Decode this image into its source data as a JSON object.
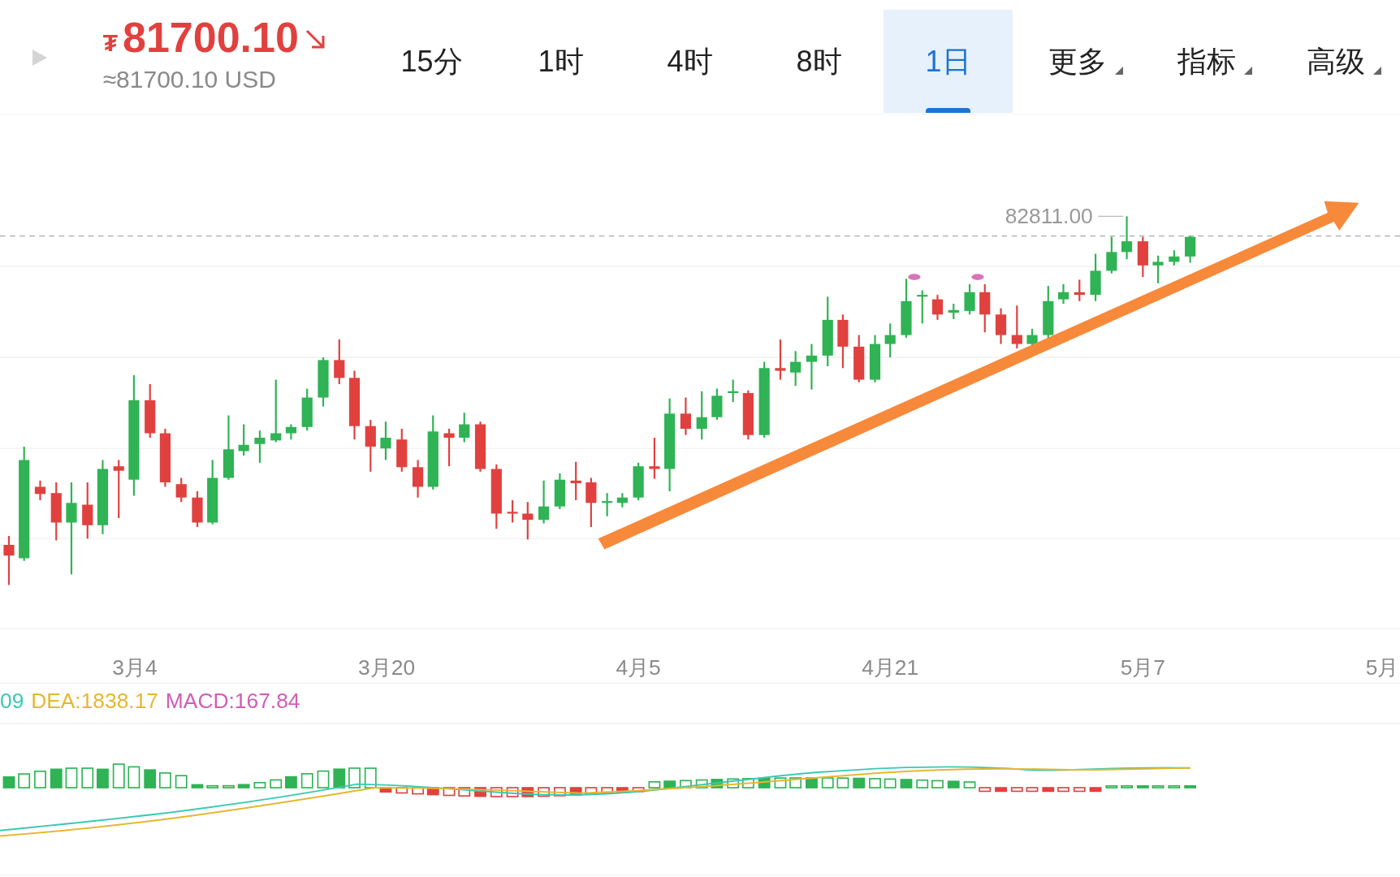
{
  "quote": {
    "currency_symbol": "₮",
    "price": "81700.10",
    "converted": "≈81700.10 USD"
  },
  "tabs": [
    {
      "label": "15分",
      "selected": false,
      "has_menu": false
    },
    {
      "label": "1时",
      "selected": false,
      "has_menu": false
    },
    {
      "label": "4时",
      "selected": false,
      "has_menu": false
    },
    {
      "label": "8时",
      "selected": false,
      "has_menu": false
    },
    {
      "label": "1日",
      "selected": true,
      "has_menu": false
    },
    {
      "label": "更多",
      "selected": false,
      "has_menu": true
    },
    {
      "label": "指标",
      "selected": false,
      "has_menu": true
    },
    {
      "label": "高级",
      "selected": false,
      "has_menu": true
    }
  ],
  "chart": {
    "high_label": "82811.00",
    "x_labels": [
      "3月4",
      "3月20",
      "4月5",
      "4月21",
      "5月7",
      "5月"
    ]
  },
  "macd_legend": [
    {
      "text": "09",
      "color": "#3cc8b4"
    },
    {
      "text": "DEA:1838.17",
      "color": "#e6b730"
    },
    {
      "text": "MACD:167.84",
      "color": "#d05cb8"
    }
  ]
}
